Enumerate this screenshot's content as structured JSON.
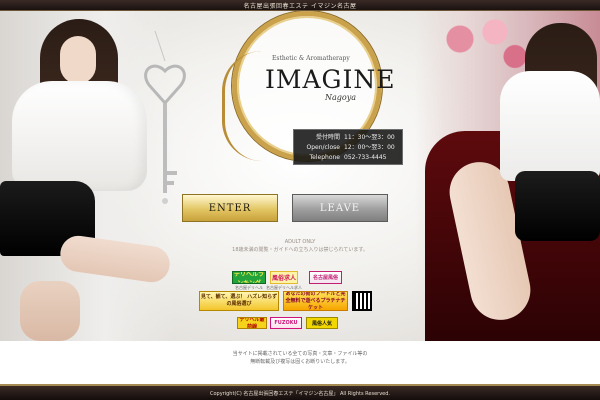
{
  "header": {
    "caption": "名古屋出張回春エステ イマジン名古屋"
  },
  "logo": {
    "sub": "Esthetic & Aromatherapy",
    "name": "IMAGINE",
    "city": "Nagoya"
  },
  "hours": [
    {
      "label": "受付時間",
      "value": "11：30～翌3：00"
    },
    {
      "label": "Open/close",
      "value": "12：00～翌3：00"
    },
    {
      "label": "Telephone",
      "value": "052-733-4445"
    }
  ],
  "buttons": {
    "enter": "ENTER",
    "leave": "LEAVE"
  },
  "adult": {
    "title": "ADULT ONLY",
    "note": "18歳未満の閲覧・ガイドへの立ち入りは禁じられています。"
  },
  "banners": {
    "b1": "デリヘルランキング",
    "b1_cap": "名古屋デリヘル",
    "b2": "風俗求人",
    "b2_cap": "名古屋デリヘル求人",
    "b3": "名古屋風俗",
    "b4": "見て、観て、選ぶ！ ハズレ知らずの風俗選び",
    "b5": "あなたの街のフードルと完全無料で遊べるプラチナチケット",
    "b6": "デリヘル最前線",
    "b7": "FUZOKU",
    "b8": "風俗人気"
  },
  "notice": {
    "line1": "当サイトに掲載されている全ての写真・文章・ファイル等の",
    "line2": "無断転載及び複写は固くお断りいたします。"
  },
  "footer": {
    "copy": "Copyright(C) 名古屋出張回春エステ「イマジン名古屋」 All Rights Reserved."
  },
  "colors": {
    "gold": "#c9a24b",
    "enter_gold": "#e3c664",
    "leave_gray": "#9e9e9e",
    "footer_dark": "#3a2a25"
  }
}
